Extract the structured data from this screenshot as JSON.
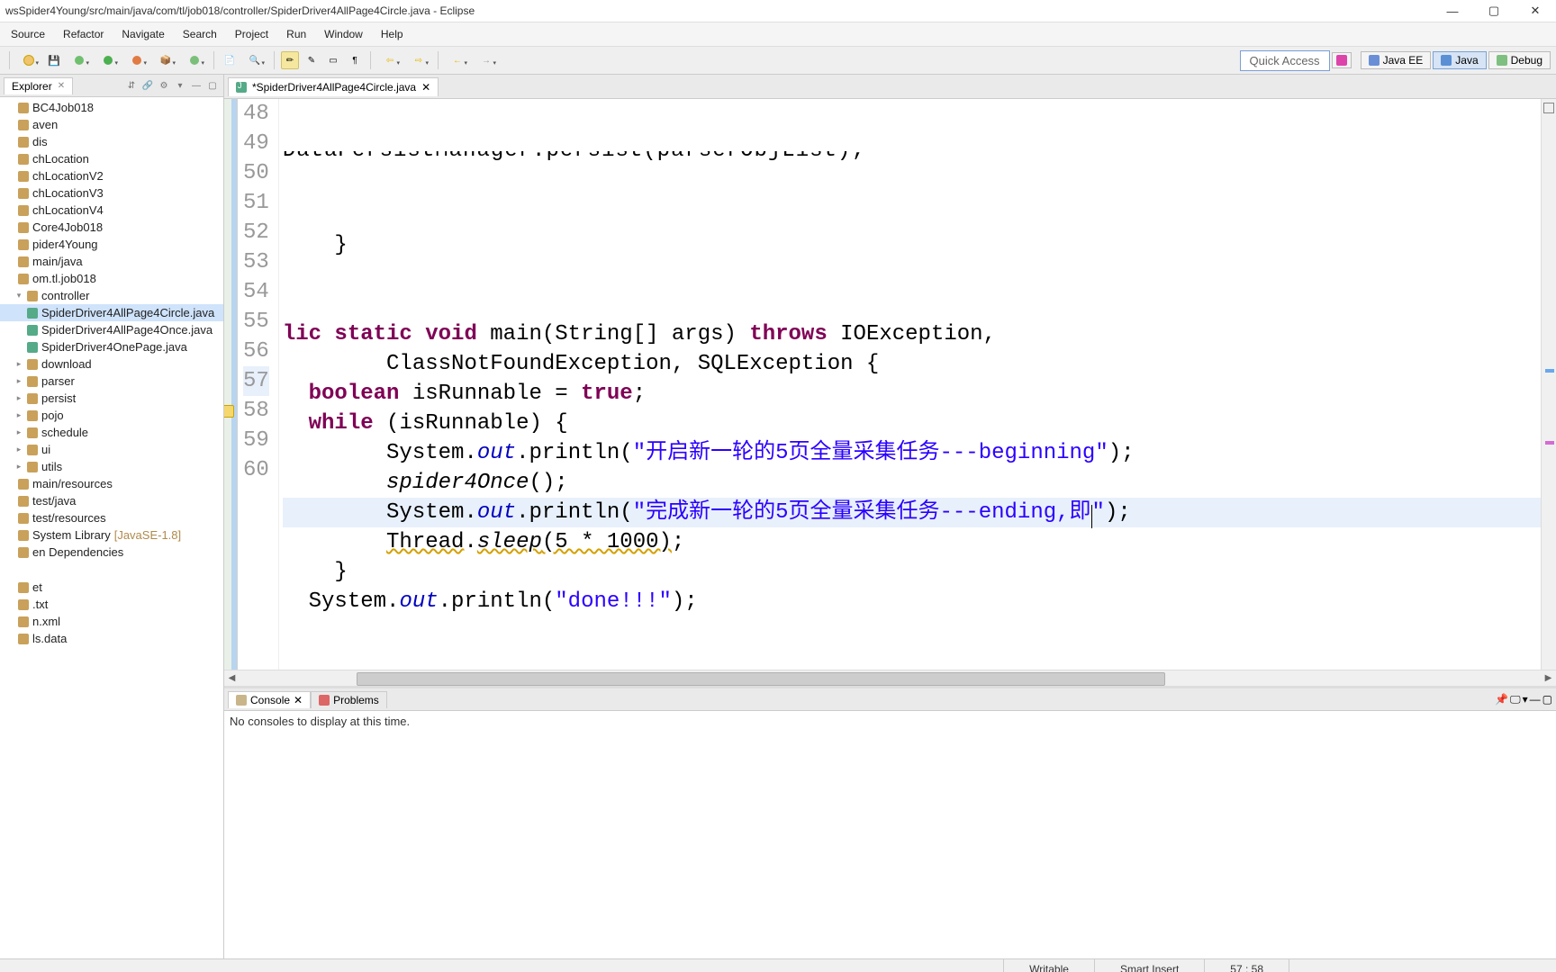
{
  "window": {
    "title": "wsSpider4Young/src/main/java/com/tl/job018/controller/SpiderDriver4AllPage4Circle.java - Eclipse"
  },
  "menus": [
    "Source",
    "Refactor",
    "Navigate",
    "Search",
    "Project",
    "Run",
    "Window",
    "Help"
  ],
  "quick_access": "Quick Access",
  "perspectives": [
    {
      "label": "Java EE",
      "active": false
    },
    {
      "label": "Java",
      "active": true
    },
    {
      "label": "Debug",
      "active": false
    }
  ],
  "explorer": {
    "tab": "Explorer",
    "items": [
      {
        "label": "BC4Job018",
        "indent": 0
      },
      {
        "label": "aven",
        "indent": 0
      },
      {
        "label": "dis",
        "indent": 0
      },
      {
        "label": "chLocation",
        "indent": 0
      },
      {
        "label": "chLocationV2",
        "indent": 0
      },
      {
        "label": "chLocationV3",
        "indent": 0
      },
      {
        "label": "chLocationV4",
        "indent": 0
      },
      {
        "label": "Core4Job018",
        "indent": 0
      },
      {
        "label": "pider4Young",
        "indent": 0
      },
      {
        "label": "main/java",
        "indent": 0
      },
      {
        "label": "om.tl.job018",
        "indent": 0
      },
      {
        "label": "controller",
        "indent": 1,
        "arrow": "▾"
      },
      {
        "label": "SpiderDriver4AllPage4Circle.java",
        "indent": 1,
        "selected": true,
        "file": true
      },
      {
        "label": "SpiderDriver4AllPage4Once.java",
        "indent": 1,
        "file": true
      },
      {
        "label": "SpiderDriver4OnePage.java",
        "indent": 1,
        "file": true
      },
      {
        "label": "download",
        "indent": 1,
        "arrow": "▸"
      },
      {
        "label": "parser",
        "indent": 1,
        "arrow": "▸"
      },
      {
        "label": "persist",
        "indent": 1,
        "arrow": "▸"
      },
      {
        "label": "pojo",
        "indent": 1,
        "arrow": "▸"
      },
      {
        "label": "schedule",
        "indent": 1,
        "arrow": "▸"
      },
      {
        "label": "ui",
        "indent": 1,
        "arrow": "▸"
      },
      {
        "label": "utils",
        "indent": 1,
        "arrow": "▸"
      },
      {
        "label": "main/resources",
        "indent": 0
      },
      {
        "label": "test/java",
        "indent": 0
      },
      {
        "label": "test/resources",
        "indent": 0
      },
      {
        "label": "System Library",
        "suffix": " [JavaSE-1.8]",
        "indent": 0
      },
      {
        "label": "en Dependencies",
        "indent": 0
      },
      {
        "label": "",
        "indent": 0,
        "blank": true
      },
      {
        "label": "et",
        "indent": 0
      },
      {
        "label": ".txt",
        "indent": 0
      },
      {
        "label": "n.xml",
        "indent": 0
      },
      {
        "label": "ls.data",
        "indent": 0
      }
    ]
  },
  "editor": {
    "tab_label": "*SpiderDriver4AllPage4Circle.java",
    "clipped_top": "DataPersistManager.persist(parserObjList);",
    "lines": [
      {
        "n": 48,
        "tokens": [
          {
            "t": "    }"
          }
        ]
      },
      {
        "n": 49,
        "tokens": []
      },
      {
        "n": 50,
        "tokens": []
      },
      {
        "n": 51,
        "tokens": [
          {
            "t": "lic static void",
            "c": "kw"
          },
          {
            "t": " main(String[] args) "
          },
          {
            "t": "throws",
            "c": "kw"
          },
          {
            "t": " IOException,"
          }
        ]
      },
      {
        "n": 52,
        "tokens": [
          {
            "t": "        ClassNotFoundException, SQLException {"
          }
        ]
      },
      {
        "n": 53,
        "tokens": [
          {
            "t": "  "
          },
          {
            "t": "boolean",
            "c": "kw"
          },
          {
            "t": " isRunnable = "
          },
          {
            "t": "true",
            "c": "kw"
          },
          {
            "t": ";"
          }
        ]
      },
      {
        "n": 54,
        "tokens": [
          {
            "t": "  "
          },
          {
            "t": "while",
            "c": "kw"
          },
          {
            "t": " (isRunnable) {"
          }
        ]
      },
      {
        "n": 55,
        "tokens": [
          {
            "t": "        System."
          },
          {
            "t": "out",
            "c": "field"
          },
          {
            "t": ".println("
          },
          {
            "t": "\"开启新一轮的5页全量采集任务---beginning\"",
            "c": "str"
          },
          {
            "t": ");"
          }
        ]
      },
      {
        "n": 56,
        "tokens": [
          {
            "t": "        "
          },
          {
            "t": "spider4Once",
            "c": "call-i"
          },
          {
            "t": "();"
          }
        ]
      },
      {
        "n": 57,
        "current": true,
        "tokens": [
          {
            "t": "        System."
          },
          {
            "t": "out",
            "c": "field"
          },
          {
            "t": ".println("
          },
          {
            "t": "\"完成新一轮的5页全量采集任务---ending,即",
            "c": "str"
          },
          {
            "cursor": true
          },
          {
            "t": "\"",
            "c": "str"
          },
          {
            "t": ");"
          }
        ]
      },
      {
        "n": 58,
        "err": true,
        "tokens": [
          {
            "t": "        "
          },
          {
            "t": "Thread",
            "c": "err-underline"
          },
          {
            "t": "."
          },
          {
            "t": "sleep",
            "c": "call-i err-underline"
          },
          {
            "t": "(5 * 1000)",
            "c": "err-underline"
          },
          {
            "t": ";"
          }
        ]
      },
      {
        "n": 59,
        "tokens": [
          {
            "t": "    }"
          }
        ]
      },
      {
        "n": 60,
        "tokens": [
          {
            "t": "  System."
          },
          {
            "t": "out",
            "c": "field"
          },
          {
            "t": ".println("
          },
          {
            "t": "\"done!!!\"",
            "c": "str"
          },
          {
            "t": ");"
          }
        ]
      }
    ]
  },
  "console": {
    "tab": "Console",
    "problems_tab": "Problems",
    "empty_text": "No consoles to display at this time."
  },
  "status": {
    "writable": "Writable",
    "insert": "Smart Insert",
    "pos": "57 : 58"
  }
}
